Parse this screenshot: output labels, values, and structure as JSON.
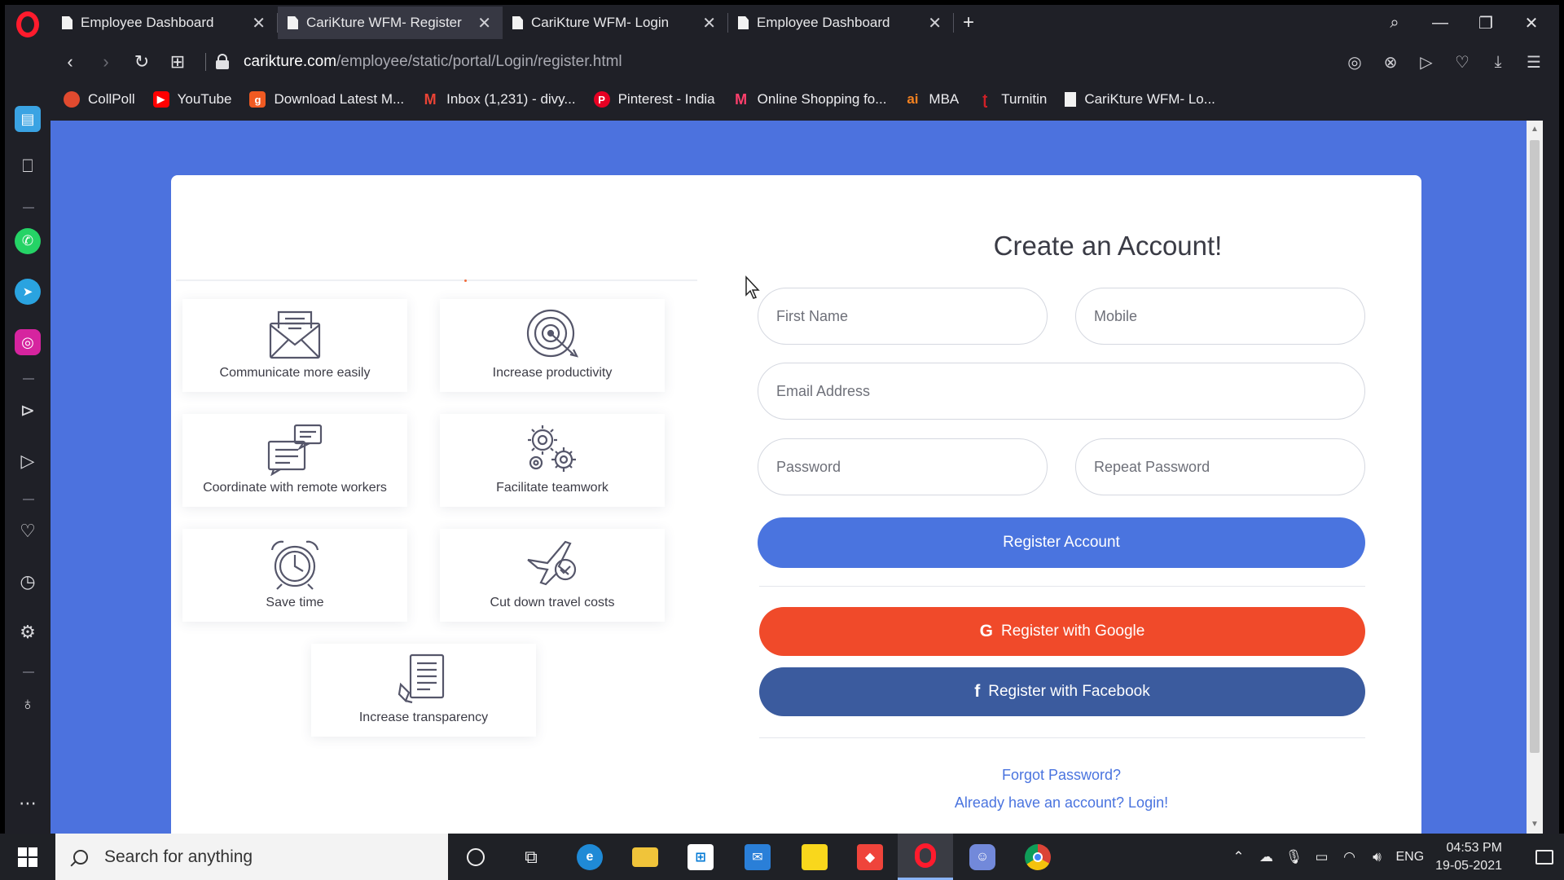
{
  "browser": {
    "tabs": [
      {
        "label": "Employee Dashboard",
        "active": false
      },
      {
        "label": "CariKture WFM- Register",
        "active": true
      },
      {
        "label": "CariKture WFM- Login",
        "active": false
      },
      {
        "label": "Employee Dashboard",
        "active": false
      }
    ],
    "new_tab_label": "+",
    "url_host": "carikture.com",
    "url_path": "/employee/static/portal/Login/register.html",
    "bookmarks": [
      {
        "label": "CollPoll",
        "icon": "collpoll-icon",
        "color": "#e04a2f"
      },
      {
        "label": "YouTube",
        "icon": "youtube-icon",
        "color": "#ff0000"
      },
      {
        "label": "Download Latest M...",
        "icon": "download-site-icon",
        "color": "#f05a22"
      },
      {
        "label": "Inbox (1,231) - divy...",
        "icon": "gmail-icon",
        "color": "#ea4335"
      },
      {
        "label": "Pinterest - India",
        "icon": "pinterest-icon",
        "color": "#e60023"
      },
      {
        "label": "Online Shopping fo...",
        "icon": "myntra-icon",
        "color": "#ff3f6c"
      },
      {
        "label": "MBA",
        "icon": "mba-icon",
        "color": "#f58220"
      },
      {
        "label": "Turnitin",
        "icon": "turnitin-icon",
        "color": "#d02027"
      },
      {
        "label": "CariKture WFM- Lo...",
        "icon": "page-icon",
        "color": "#f2f2f2"
      }
    ]
  },
  "page": {
    "form": {
      "title": "Create an Account!",
      "first_name_placeholder": "First Name",
      "mobile_placeholder": "Mobile",
      "email_placeholder": "Email Address",
      "password_placeholder": "Password",
      "repeat_password_placeholder": "Repeat Password",
      "register_label": "Register Account",
      "google_label": "Register with Google",
      "facebook_label": "Register with Facebook",
      "forgot_label": "Forgot Password?",
      "login_label": "Already have an account? Login!"
    },
    "features": [
      {
        "label": "Communicate more easily",
        "icon": "envelope-icon"
      },
      {
        "label": "Increase productivity",
        "icon": "target-icon"
      },
      {
        "label": "Coordinate with remote workers",
        "icon": "chat-icon"
      },
      {
        "label": "Facilitate teamwork",
        "icon": "gears-icon"
      },
      {
        "label": "Save time",
        "icon": "alarm-clock-icon"
      },
      {
        "label": "Cut down travel costs",
        "icon": "airplane-icon"
      },
      {
        "label": "Increase transparency",
        "icon": "document-icon"
      }
    ],
    "colors": {
      "background": "#4c72de",
      "primary": "#4a74df",
      "google": "#f04a2a",
      "facebook": "#3b5b9e"
    }
  },
  "taskbar": {
    "search_placeholder": "Search for anything",
    "language": "ENG",
    "time": "04:53 PM",
    "date": "19-05-2021"
  }
}
